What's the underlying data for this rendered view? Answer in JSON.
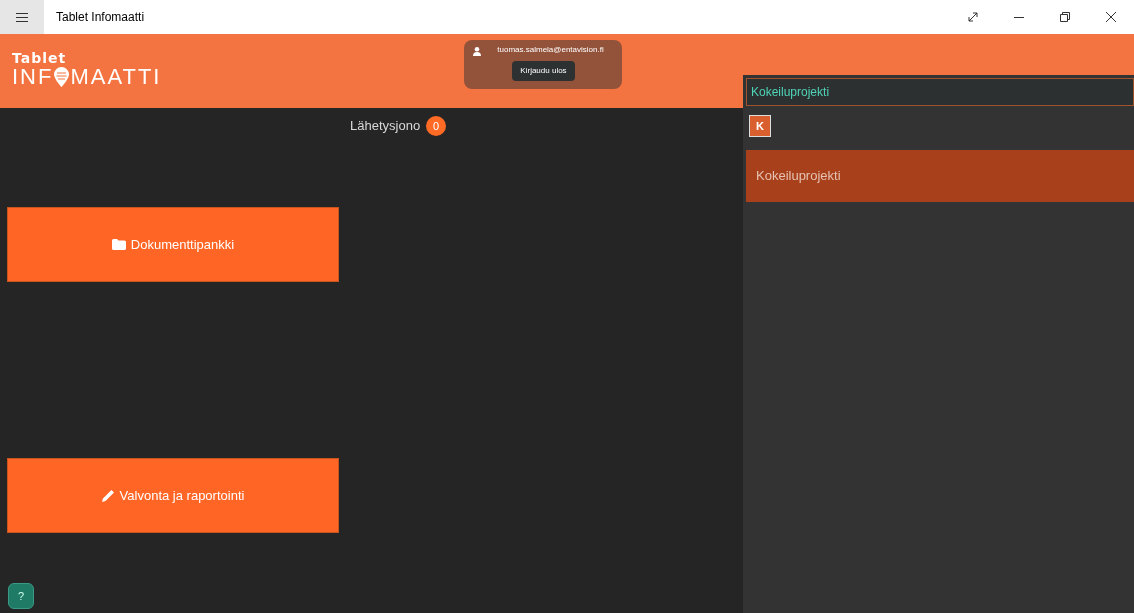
{
  "window": {
    "title": "Tablet Infomaatti"
  },
  "logo": {
    "top": "Tablet",
    "bottom_before_icon": "INF",
    "bottom_after_icon": "MAATTI"
  },
  "user": {
    "email": "tuomas.salmela@entavision.fi",
    "logout": "Kirjaudu ulos"
  },
  "queue": {
    "label": "Lähetysjono",
    "count": "0"
  },
  "tiles": [
    {
      "kind": "folder",
      "label": "Dokumenttipankki"
    },
    {
      "kind": "pencil",
      "label": "Valvonta ja raportointi"
    }
  ],
  "help": "?",
  "project_panel": {
    "search_value": "Kokeiluprojekti",
    "letters": [
      {
        "label": "K",
        "selected": true
      }
    ],
    "projects": [
      {
        "label": "Kokeiluprojekti",
        "selected": true
      }
    ]
  }
}
